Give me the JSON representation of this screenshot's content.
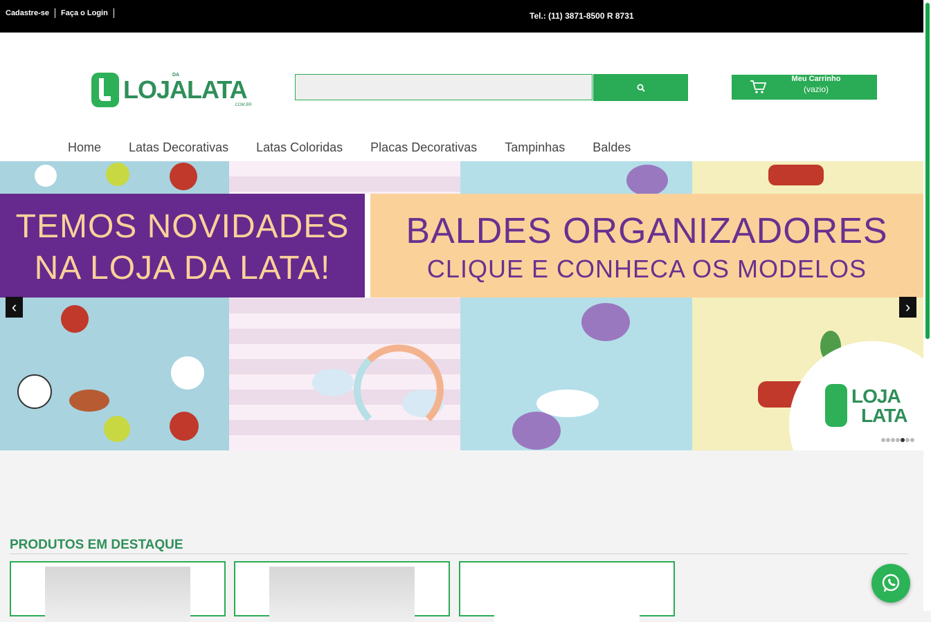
{
  "topbar": {
    "register_label": "Cadastre-se",
    "login_label": "Faça o Login",
    "phone": "Tel.: (11) 3871-8500 R 8731"
  },
  "header": {
    "logo_word": "LOJALATA",
    "logo_da": "DA",
    "logo_com": ".COM.BR",
    "search_placeholder": "",
    "cart_title": "Meu Carrinho",
    "cart_status": "(vazio)"
  },
  "nav": {
    "items": [
      "Home",
      "Latas Decorativas",
      "Latas Coloridas",
      "Placas Decorativas",
      "Tampinhas",
      "Baldes"
    ]
  },
  "banner": {
    "left_line1": "TEMOS NOVIDADES",
    "left_line2": "NA LOJA DA LATA!",
    "right_line1": "BALDES ORGANIZADORES",
    "right_line2": "CLIQUE E CONHECA OS MODELOS",
    "badge_word1": "LOJA",
    "badge_word2": "LATA",
    "slide_count": 7,
    "active_slide": 5
  },
  "featured": {
    "title": "PRODUTOS EM DESTAQUE"
  },
  "colors": {
    "brand_green": "#2aab55",
    "purple": "#66298d",
    "peach": "#fbd19a"
  }
}
